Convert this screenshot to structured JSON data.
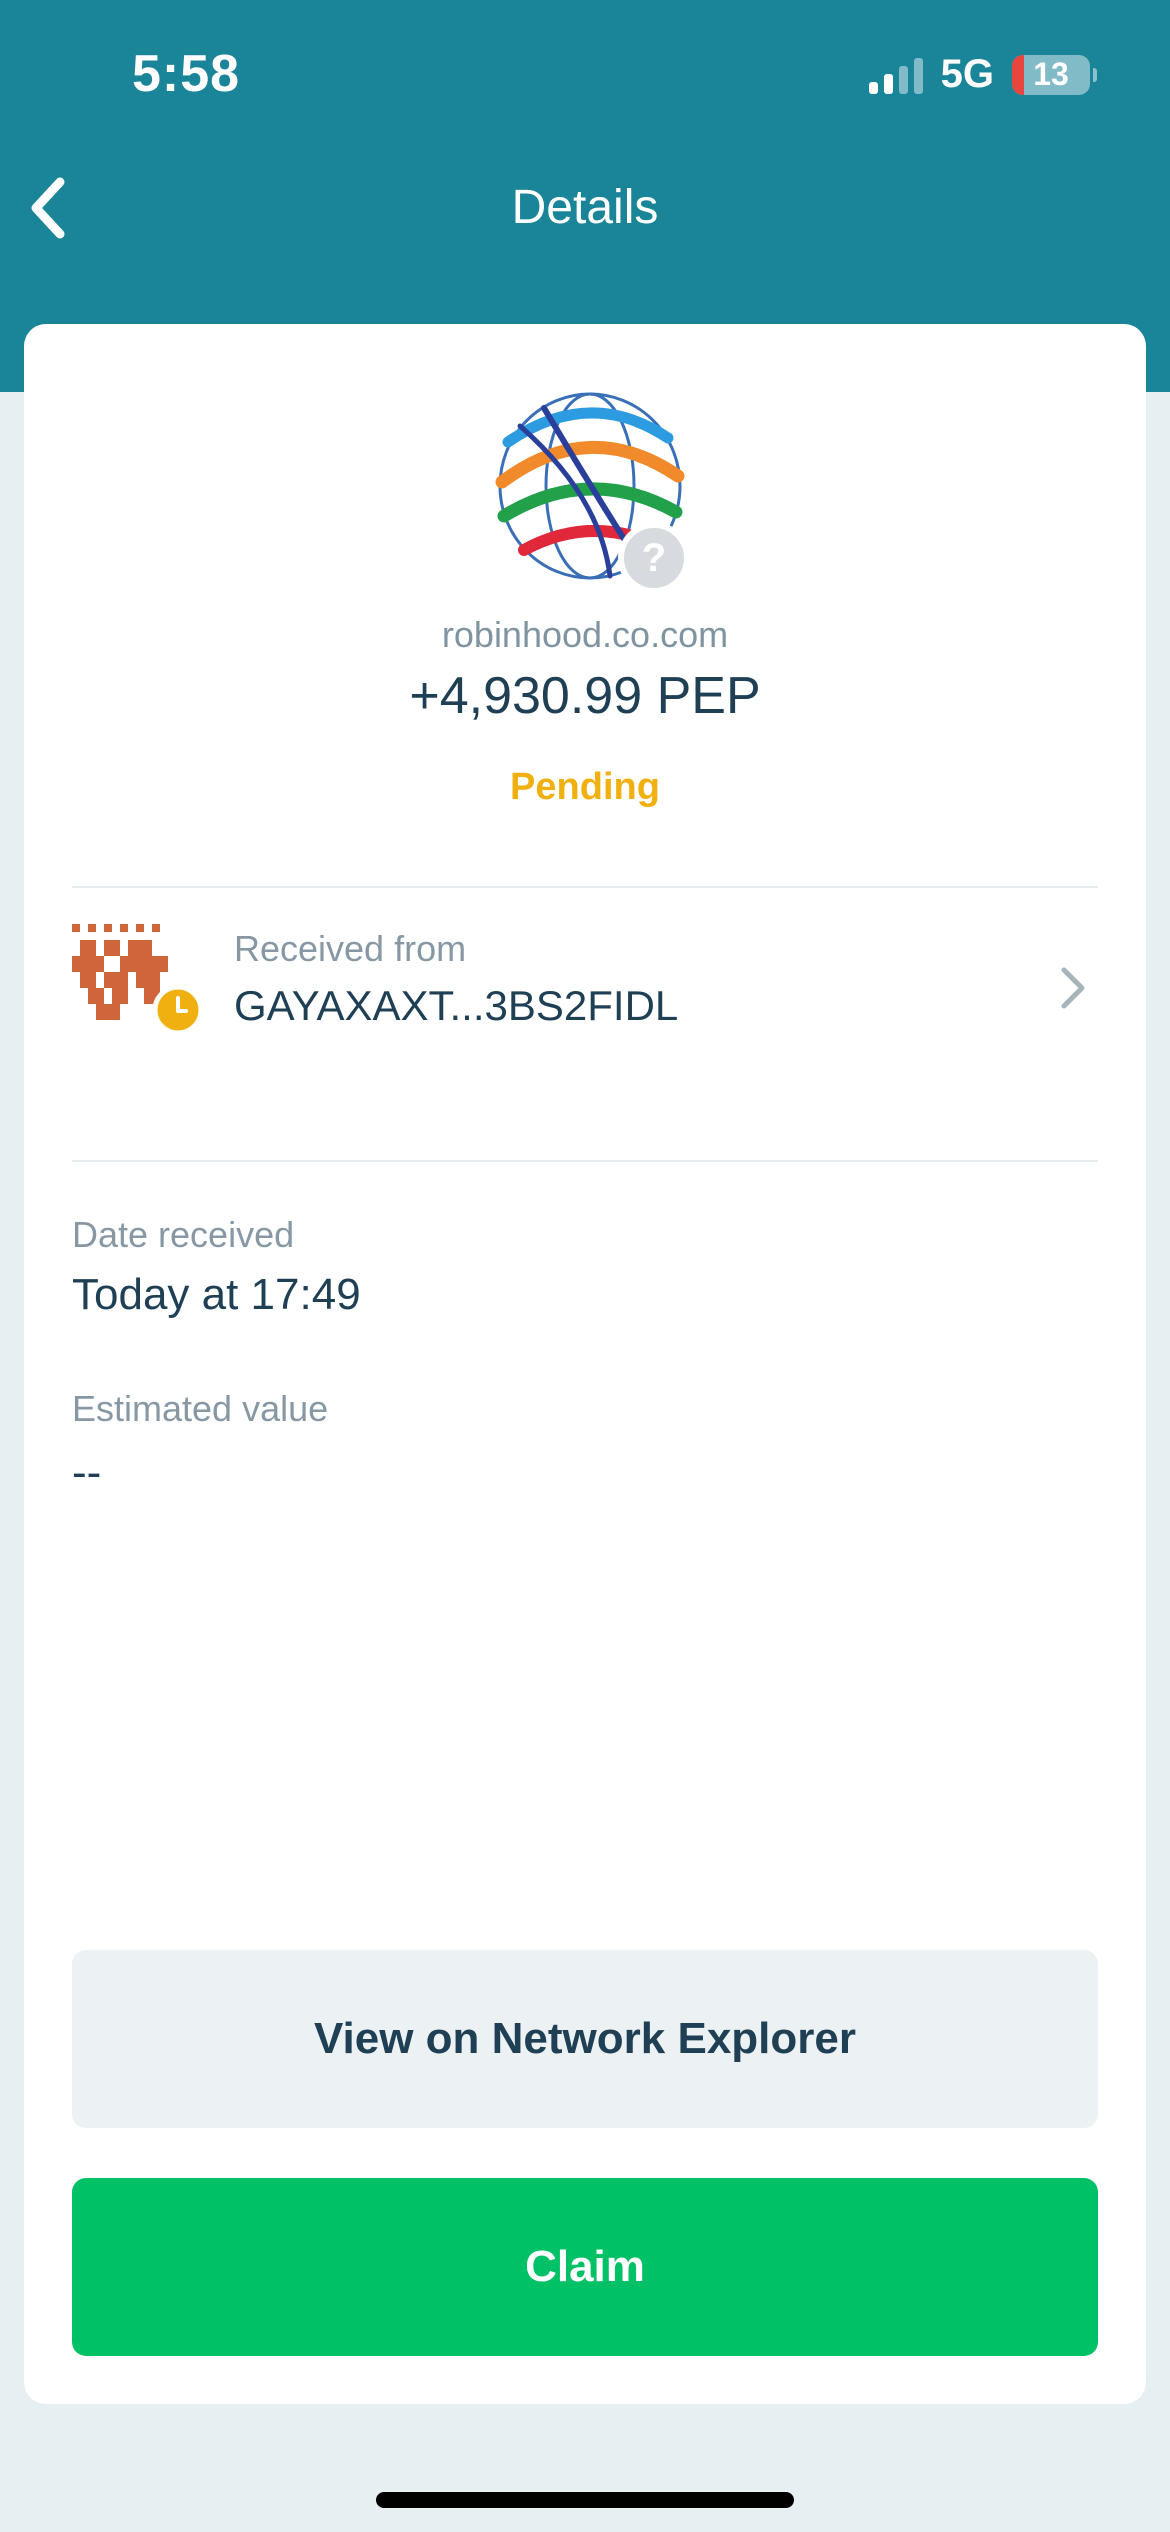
{
  "status_bar": {
    "time": "5:58",
    "network": "5G",
    "battery": "13"
  },
  "nav": {
    "title": "Details",
    "back_icon": "chevron-left-icon"
  },
  "token": {
    "logo_icon": "globe-logo-icon",
    "badge_icon": "question-mark-icon",
    "badge_text": "?",
    "domain": "robinhood.co.com",
    "amount": "+4,930.99 PEP",
    "status": "Pending"
  },
  "sender": {
    "label": "Received from",
    "address": "GAYAXAXT...3BS2FIDL",
    "avatar_icon": "identicon-avatar",
    "pending_icon": "clock-icon"
  },
  "details": {
    "date_label": "Date received",
    "date_value": "Today at 17:49",
    "value_label": "Estimated value",
    "value_value": "--"
  },
  "actions": {
    "explorer_label": "View on Network Explorer",
    "claim_label": "Claim"
  },
  "colors": {
    "header": "#1a8499",
    "pending": "#f0b010",
    "claim": "#00c165",
    "text_primary": "#1f3f55",
    "text_secondary": "#8798a4"
  }
}
